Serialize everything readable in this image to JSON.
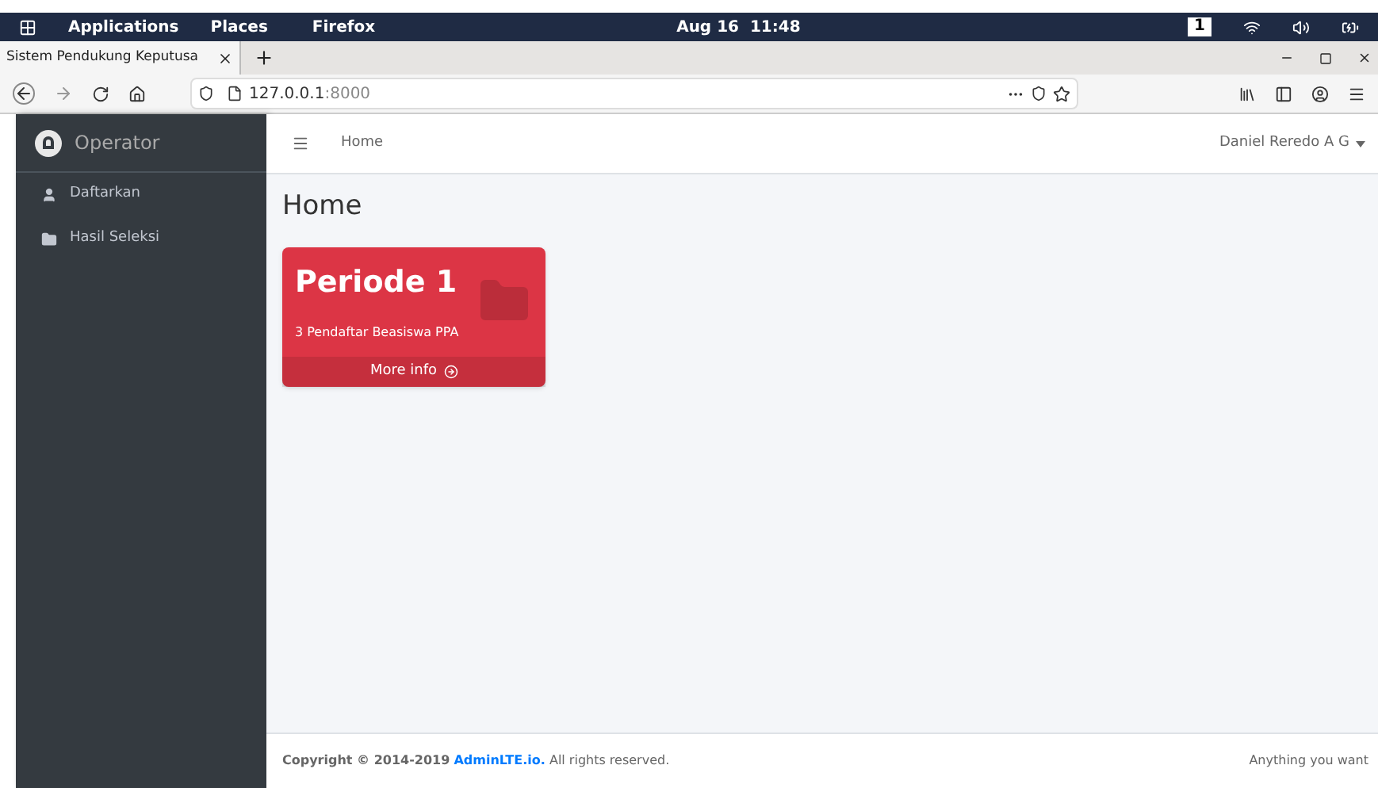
{
  "desktop_bar": {
    "menus": [
      "Applications",
      "Places"
    ],
    "app": "Firefox",
    "clock": "Aug 16  11:48",
    "workspace": "1"
  },
  "browser": {
    "tabs": [
      {
        "title": "Sistem Pendukung Keputusa",
        "selected": true
      }
    ],
    "url_host": "127.0.0.1",
    "url_port": ":8000"
  },
  "sidebar": {
    "brand": "Operator",
    "items": [
      {
        "label": "Daftarkan"
      },
      {
        "label": "Hasil Seleksi"
      }
    ]
  },
  "navbar": {
    "breadcrumb": "Home",
    "user": "Daniel Reredo A G"
  },
  "page_title": "Home",
  "cards": [
    {
      "title": "Periode 1",
      "subtitle": "3 Pendaftar Beasiswa PPA",
      "link": "More info",
      "color": "#dc3545"
    }
  ],
  "footer": {
    "copyright": "**Copyright © 2014-2019**",
    "link": "AdminLTE.io.",
    "rest": " All rights reserved.",
    "right": "Anything you want"
  }
}
